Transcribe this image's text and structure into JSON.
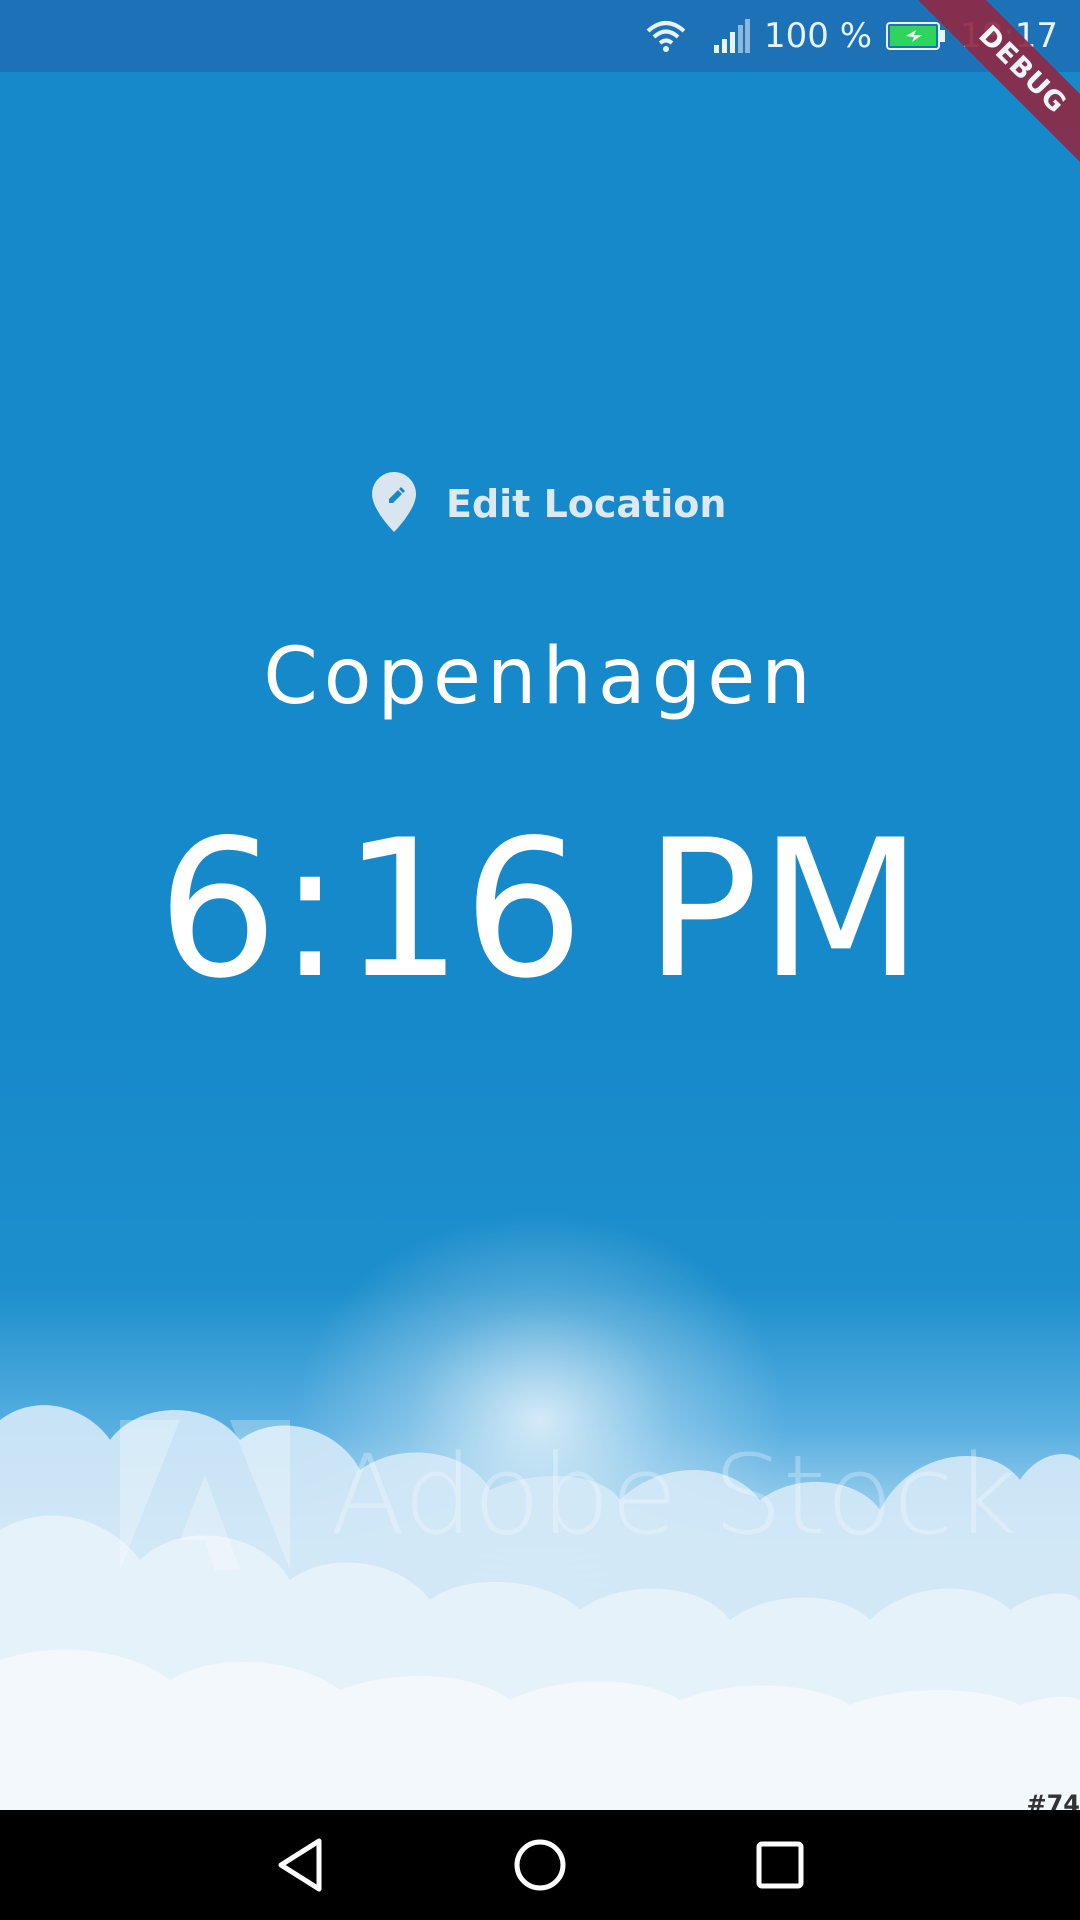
{
  "status_bar": {
    "battery_percent": "100 %",
    "clock": "18:17",
    "battery_color": "#2fd45b"
  },
  "debug_banner": {
    "label": "DEBUG"
  },
  "edit_location": {
    "label": "Edit Location",
    "icon": "edit-location-icon"
  },
  "location": {
    "city": "Copenhagen",
    "time": "6:16 PM"
  },
  "background": {
    "watermark": "Adobe Stock",
    "corner_text": "#74"
  },
  "nav_bar": {
    "icons": [
      "back-icon",
      "home-icon",
      "recents-icon"
    ]
  }
}
